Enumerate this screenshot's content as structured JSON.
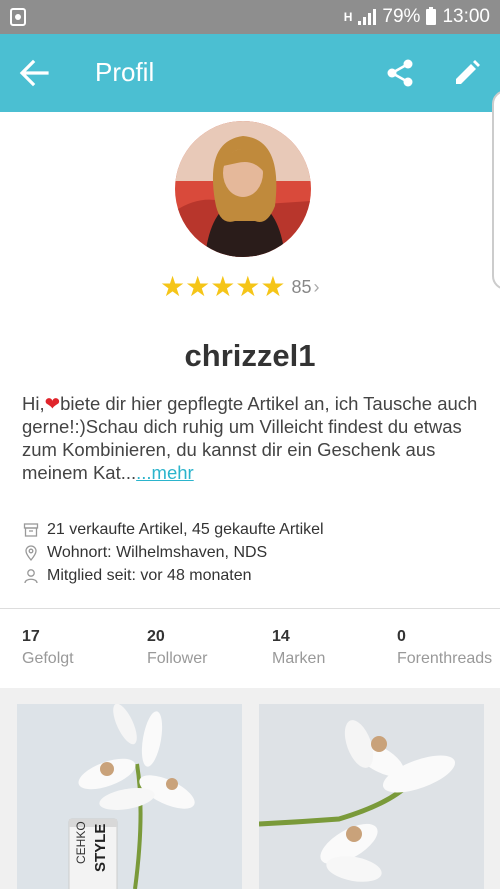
{
  "status": {
    "network": "H",
    "battery": "79%",
    "time": "13:00"
  },
  "header": {
    "title": "Profil"
  },
  "profile": {
    "rating_count": "85",
    "username": "chrizzel1",
    "bio_part1": "Hi,",
    "bio_part2": "biete dir hier gepflegte Artikel an, ich Tausche auch gerne!:)Schau dich ruhig um Villeicht findest du etwas zum Kombinieren, du kannst dir ein Geschenk aus meinem Kat...",
    "more_link": "...mehr",
    "sold_bought": "21 verkaufte Artikel, 45 gekaufte Artikel",
    "location": "Wohnort: Wilhelmshaven, NDS",
    "member_since": "Mitglied seit: vor 48 monaten"
  },
  "stats": [
    {
      "value": "17",
      "label": "Gefolgt"
    },
    {
      "value": "20",
      "label": "Follower"
    },
    {
      "value": "14",
      "label": "Marken"
    },
    {
      "value": "0",
      "label": "Forenthreads"
    }
  ],
  "items": [
    {
      "product_text_brand": "CEHKO",
      "product_text_line": "STYLE"
    }
  ],
  "colors": {
    "accent": "#4bbfd2",
    "star": "#f5c518",
    "link": "#2bb4cc"
  }
}
